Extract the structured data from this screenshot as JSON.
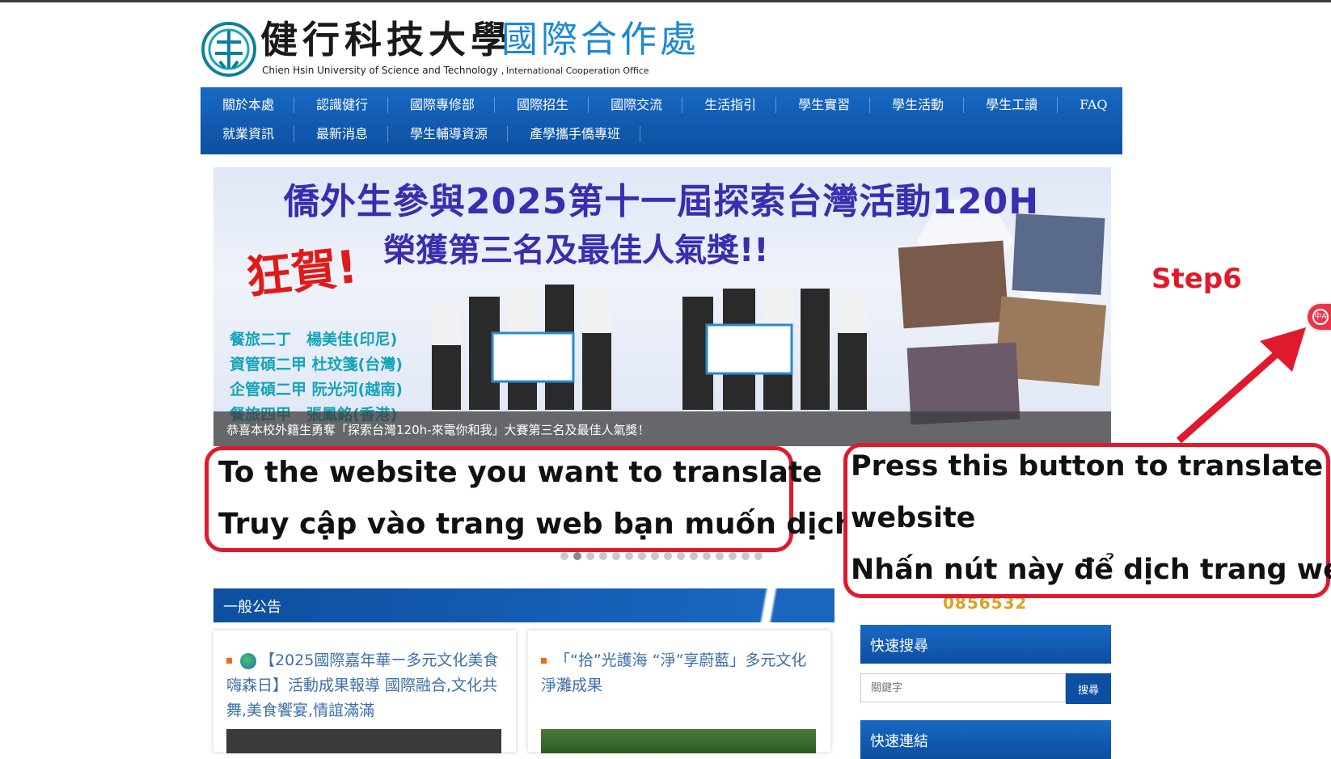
{
  "header": {
    "school_cn": "健行科技大學",
    "office_cn": "國際合作處",
    "school_en": "Chien Hsin University of Science and Technology ,",
    "office_en": "International Cooperation Office"
  },
  "nav": {
    "row1": [
      "關於本處",
      "認識健行",
      "國際專修部",
      "國際招生",
      "國際交流",
      "生活指引",
      "學生實習",
      "學生活動",
      "學生工讀",
      "FAQ"
    ],
    "row2": [
      "就業資訊",
      "最新消息",
      "學生輔導資源",
      "產學攜手僑專班"
    ]
  },
  "banner": {
    "title_line1": "僑外生參與2025第十一屆探索台灣活動120H",
    "title_line2": "榮獲第三名及最佳人氣獎!!",
    "congrats": "狂賀!",
    "names": [
      "餐旅二丁　楊美佳(印尼)",
      "資管碩二甲 杜玟箋(台灣)",
      "企管碩二甲 阮光河(越南)",
      "餐旅四甲　張鳳銘(香港)"
    ],
    "caption": "恭喜本校外籍生勇奪「探索台灣120h-來電你和我」大賽第三名及最佳人氣獎！",
    "slide_count": 16,
    "active_slide": 2
  },
  "announcements": {
    "title": "一般公告",
    "items": [
      "【2025國際嘉年華ー多元文化美食嗨森日】活動成果報導 國際融合,文化共舞,美食饗宴,情誼滿滿",
      "「“拾”光護海 “淨”享蔚藍」多元文化淨灘成果"
    ]
  },
  "sidebar": {
    "counter": "0856532",
    "search_title": "快速搜尋",
    "search_placeholder": "關鍵字",
    "search_button": "搜尋",
    "links_title": "快速連結"
  },
  "translate_button": {
    "icon": "translate-icon",
    "glyph": "中A"
  },
  "tutorial": {
    "step": "Step6",
    "left_line1": "To the website you want to translate",
    "left_line2": "Truy cập vào trang web bạn muốn dịch",
    "right_line1": "Press this button to translate the",
    "right_line2": "website",
    "right_line3": "Nhấn nút này để dịch trang web"
  },
  "colors": {
    "nav_blue": "#0d4fa0",
    "accent_red": "#e0192e",
    "logo_blue": "#1e88d6"
  }
}
